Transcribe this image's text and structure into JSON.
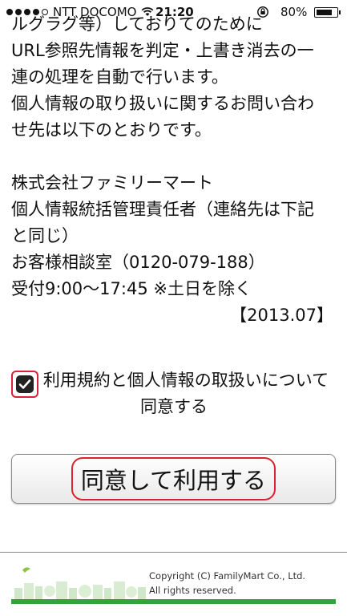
{
  "status_bar": {
    "carrier": "NTT DOCOMO",
    "time": "21:20",
    "battery": "80%",
    "signal_bars": 4,
    "signal_total": 5
  },
  "content": {
    "partial_line": "ルグラグ等）しておりてのために",
    "lines_1": [
      "URL参照先情報を判定・上書き消去の一",
      "連の処理を自動で行います。",
      "個人情報の取り扱いに関するお問い合わ",
      "せ先は以下のとおりです。"
    ],
    "lines_2": [
      "株式会社ファミリーマート",
      "個人情報統括管理責任者（連絡先は下記",
      "と同じ）",
      "お客様相談室（0120-079-188）",
      "受付9:00〜17:45 ※土日を除く"
    ],
    "date": "【2013.07】"
  },
  "agree": {
    "checkbox_checked": true,
    "text_line1": "利用規約と個人情報の取扱いについて",
    "text_line2": "同意する",
    "button_label": "同意して利用する"
  },
  "footer": {
    "copyright_line1": "Copyright (C) FamilyMart Co., Ltd.",
    "copyright_line2": "All rights reserved.",
    "accent_color": "#31a43a"
  }
}
